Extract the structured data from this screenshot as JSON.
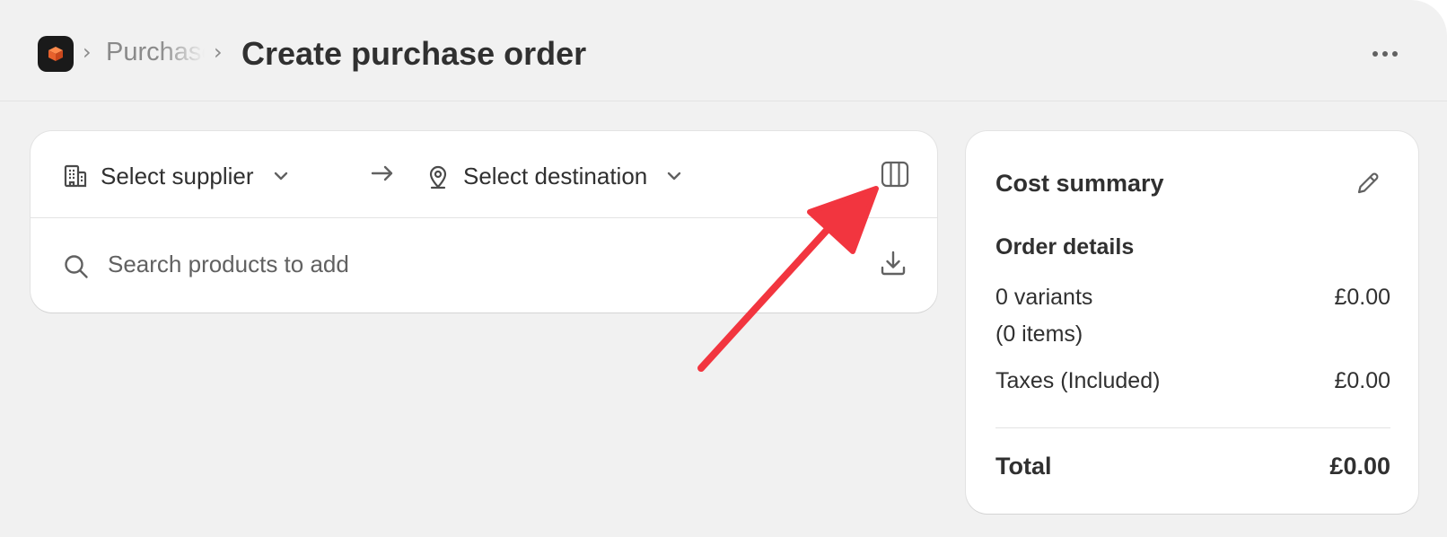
{
  "header": {
    "breadcrumb_parent": "Purchase orders",
    "title": "Create purchase order"
  },
  "order_setup": {
    "supplier_label": "Select supplier",
    "destination_label": "Select destination",
    "search_placeholder": "Search products to add"
  },
  "cost_summary": {
    "title": "Cost summary",
    "subtitle": "Order details",
    "variants_label": "0 variants",
    "items_label": "(0 items)",
    "variants_value": "£0.00",
    "taxes_label": "Taxes (Included)",
    "taxes_value": "£0.00",
    "total_label": "Total",
    "total_value": "£0.00"
  },
  "icons": {
    "app": "app-logo-icon",
    "supplier": "building-icon",
    "destination": "location-pin-icon",
    "columns": "columns-icon",
    "search": "search-icon",
    "import": "download-icon",
    "edit": "pencil-icon",
    "more": "more-horizontal-icon"
  },
  "colors": {
    "page_bg": "#f1f1f1",
    "card_bg": "#ffffff",
    "annotation_arrow": "#f2353f",
    "logo_orange": "#e8612c"
  }
}
